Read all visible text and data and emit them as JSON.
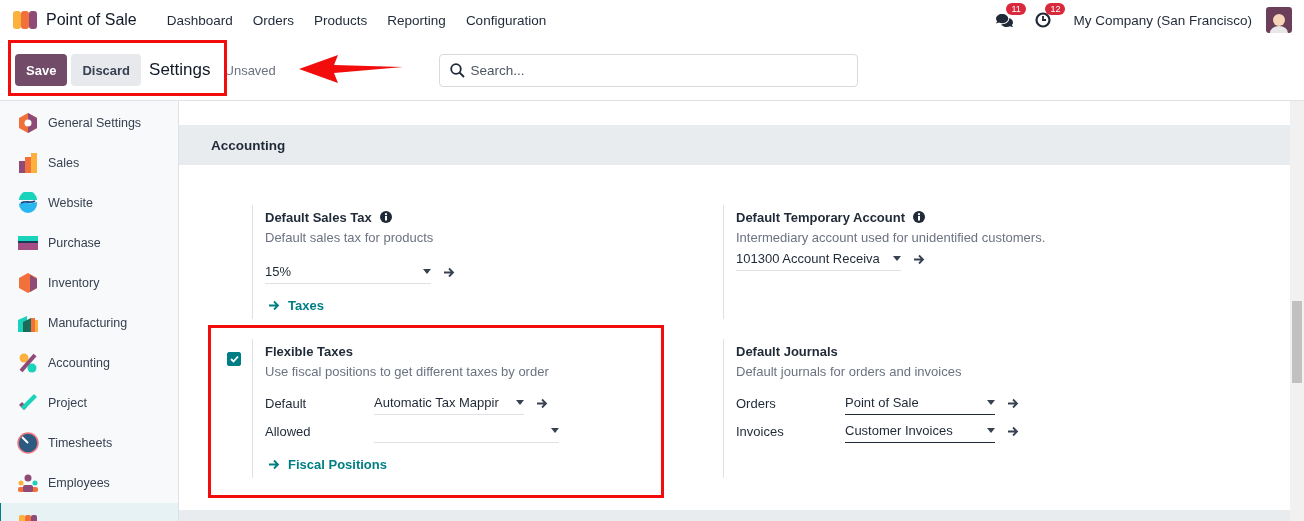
{
  "app": {
    "title": "Point of Sale"
  },
  "menu": [
    {
      "label": "Dashboard"
    },
    {
      "label": "Orders"
    },
    {
      "label": "Products"
    },
    {
      "label": "Reporting"
    },
    {
      "label": "Configuration"
    }
  ],
  "systray": {
    "messages_count": "11",
    "activities_count": "12",
    "company": "My Company (San Francisco)"
  },
  "control_panel": {
    "save": "Save",
    "discard": "Discard",
    "breadcrumb": "Settings",
    "status": "Unsaved",
    "search": {
      "placeholder": "Search..."
    }
  },
  "sidebar": {
    "items": [
      {
        "label": "General Settings",
        "selected": false
      },
      {
        "label": "Sales",
        "selected": false
      },
      {
        "label": "Website",
        "selected": false
      },
      {
        "label": "Purchase",
        "selected": false
      },
      {
        "label": "Inventory",
        "selected": false
      },
      {
        "label": "Manufacturing",
        "selected": false
      },
      {
        "label": "Accounting",
        "selected": false
      },
      {
        "label": "Project",
        "selected": false
      },
      {
        "label": "Timesheets",
        "selected": false
      },
      {
        "label": "Employees",
        "selected": false
      },
      {
        "selected": true
      }
    ]
  },
  "section": {
    "title": "Accounting",
    "settings": [
      {
        "title": "Default Sales Tax",
        "info": true,
        "description": "Default sales tax for products",
        "field": {
          "value": "15%"
        },
        "link": "Taxes"
      },
      {
        "title": "Default Temporary Account",
        "info": true,
        "description": "Intermediary account used for unidentified customers.",
        "field": {
          "value": "101300 Account Receiva"
        }
      },
      {
        "title": "Flexible Taxes",
        "checkbox": {
          "checked": true
        },
        "description": "Use fiscal positions to get different taxes by order",
        "rows": [
          {
            "label": "Default",
            "value": "Automatic Tax Mappir",
            "required": false,
            "open": true
          },
          {
            "label": "Allowed",
            "required": false,
            "open": false
          }
        ],
        "link": "Fiscal Positions"
      },
      {
        "title": "Default Journals",
        "description": "Default journals for orders and invoices",
        "rows": [
          {
            "label": "Orders",
            "value": "Point of Sale",
            "required": true,
            "open": true
          },
          {
            "label": "Invoices",
            "value": "Customer Invoices",
            "required": true,
            "open": true
          }
        ]
      }
    ]
  }
}
